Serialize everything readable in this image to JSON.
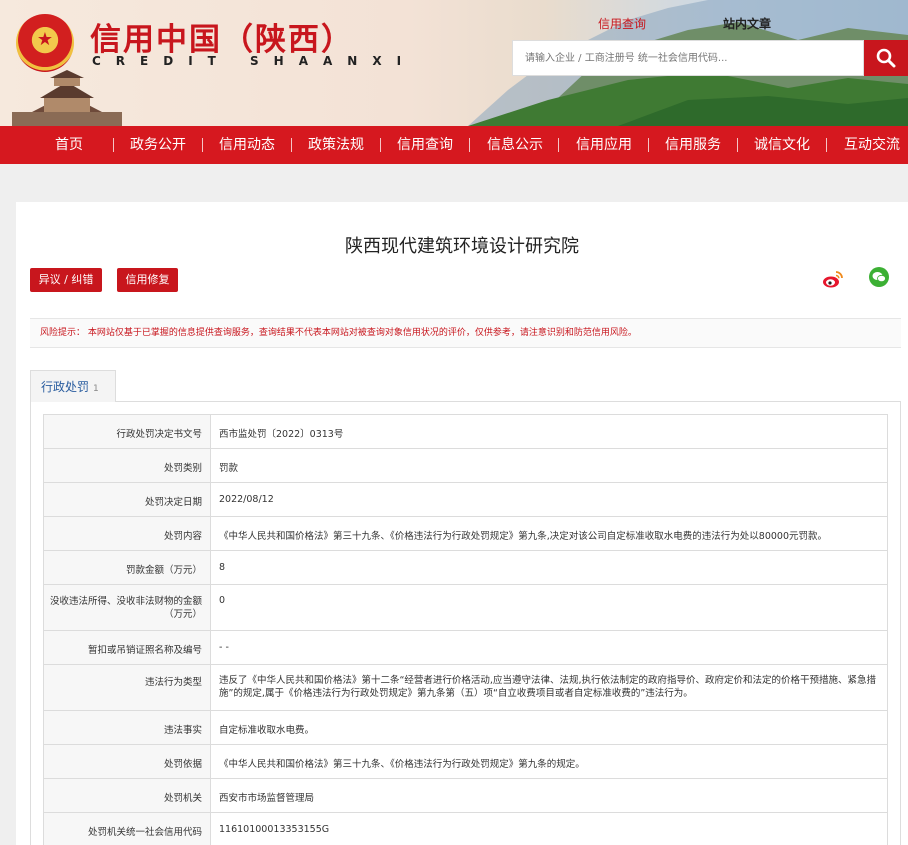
{
  "header": {
    "title": "信用中国（陕西）",
    "subtitle": "CREDIT SHAANXI",
    "links": [
      "信用查询",
      "站内文章"
    ],
    "search_placeholder": "请输入企业 / 工商注册号 统一社会信用代码..."
  },
  "nav": [
    "首页",
    "政务公开",
    "信用动态",
    "政策法规",
    "信用查询",
    "信息公示",
    "信用应用",
    "信用服务",
    "诚信文化",
    "互动交流"
  ],
  "company": "陕西现代建筑环境设计研究院",
  "buttons": {
    "objection": "异议 / 纠错",
    "repair": "信用修复"
  },
  "risk_notice": "风险提示： 本网站仅基于已掌握的信息提供查询服务，查询结果不代表本网站对被查询对象信用状况的评价，仅供参考，请注意识别和防范信用风险。",
  "tab": {
    "label": "行政处罚",
    "count": "1"
  },
  "rows": [
    {
      "key": "行政处罚决定书文号",
      "value": "西市监处罚〔2022〕0313号"
    },
    {
      "key": "处罚类别",
      "value": "罚款"
    },
    {
      "key": "处罚决定日期",
      "value": "2022/08/12"
    },
    {
      "key": "处罚内容",
      "value": "《中华人民共和国价格法》第三十九条、《价格违法行为行政处罚规定》第九条,决定对该公司自定标准收取水电费的违法行为处以80000元罚款。"
    },
    {
      "key": "罚款金额（万元）",
      "value": "8"
    },
    {
      "key": "没收违法所得、没收非法财物的金额（万元）",
      "value": "0"
    },
    {
      "key": "暂扣或吊销证照名称及编号",
      "value": "- -"
    },
    {
      "key": "违法行为类型",
      "value": "违反了《中华人民共和国价格法》第十二条“经营者进行价格活动,应当遵守法律、法规,执行依法制定的政府指导价、政府定价和法定的价格干预措施、紧急措施”的规定,属于《价格违法行为行政处罚规定》第九条第（五）项“自立收费项目或者自定标准收费的”违法行为。"
    },
    {
      "key": "违法事实",
      "value": "自定标准收取水电费。"
    },
    {
      "key": "处罚依据",
      "value": "《中华人民共和国价格法》第三十九条、《价格违法行为行政处罚规定》第九条的规定。"
    },
    {
      "key": "处罚机关",
      "value": "西安市市场监督管理局"
    },
    {
      "key": "处罚机关统一社会信用代码",
      "value": "11610100013353155G"
    }
  ]
}
